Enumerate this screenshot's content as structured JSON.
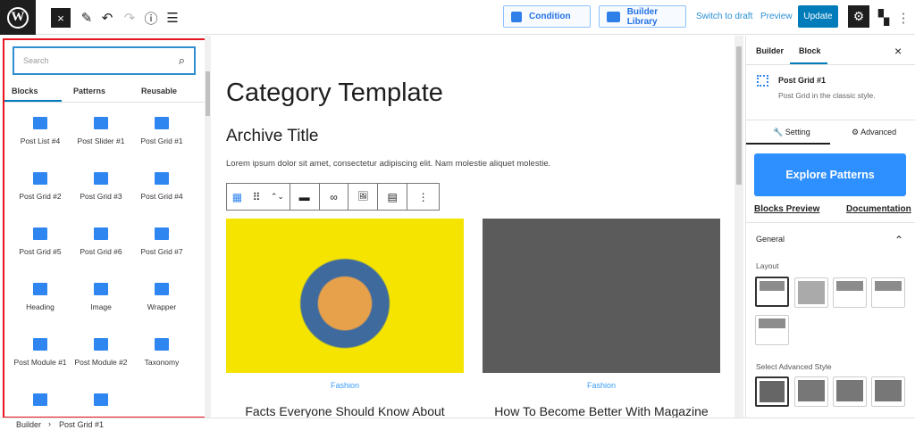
{
  "topbar": {
    "logo": "W",
    "close": "×",
    "pen": "✎",
    "undo": "↶",
    "redo": "↷",
    "info": "ⓘ",
    "list": "☰",
    "condition": "Condition",
    "builder_library": "Builder Library",
    "switch_draft": "Switch to draft",
    "preview": "Preview",
    "update": "Update",
    "gear": "⚙",
    "more": "⋮"
  },
  "inserter": {
    "search_placeholder": "Search",
    "search_icon": "⌕",
    "tabs": [
      "Blocks",
      "Patterns",
      "Reusable"
    ],
    "blocks": [
      "Post List #4",
      "Post Slider #1",
      "Post Grid #1",
      "Post Grid #2",
      "Post Grid #3",
      "Post Grid #4",
      "Post Grid #5",
      "Post Grid #6",
      "Post Grid #7",
      "Heading",
      "Image",
      "Wrapper",
      "Post Module #1",
      "Post Module #2",
      "Taxonomy",
      "",
      ""
    ]
  },
  "canvas": {
    "title": "Category Template",
    "archive_title": "Archive Title",
    "lorem": "Lorem ipsum dolor sit amet, consectetur adipiscing elit. Nam molestie aliquet molestie.",
    "toolbar": [
      "▦",
      "⠿",
      "⌃⌄",
      "▬",
      "∞",
      "🖼",
      "▤",
      "⋮"
    ],
    "posts": [
      {
        "category": "Fashion",
        "title": "Facts Everyone Should Know About"
      },
      {
        "category": "Fashion",
        "title": "How To Become Better With Magazine"
      }
    ]
  },
  "sidebar": {
    "tabs": [
      "Builder",
      "Block"
    ],
    "close": "×",
    "block_title": "Post Grid #1",
    "block_desc": "Post Grid in the classic style.",
    "setting": "Setting",
    "advanced": "Advanced",
    "explore": "Explore Patterns",
    "blocks_preview": "Blocks Preview",
    "documentation": "Documentation",
    "general": "General",
    "chevron": "⌃",
    "layout": "Layout",
    "adv_style": "Select Advanced Style"
  },
  "footer": {
    "crumbs": [
      "Builder",
      "Post Grid #1"
    ],
    "sep": "›"
  }
}
